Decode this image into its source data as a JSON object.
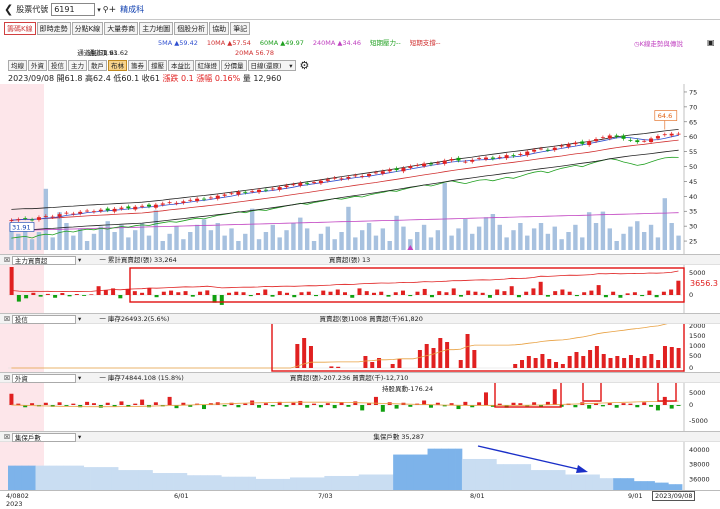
{
  "topbar": {
    "stock_code_label": "股票代號",
    "stock_code_value": "6191",
    "stock_name": "精成科"
  },
  "tabs": [
    "籌碼K線",
    "即時走勢",
    "分點K線",
    "大量券商",
    "主力地圖",
    "個股分析",
    "協助",
    "筆記"
  ],
  "legend": {
    "ma5": "5MA ▲59.42",
    "ma10": "10MA ▲57.54",
    "ma60": "60MA ▲49.97",
    "ma240": "240MA ▲34.46",
    "short_pressure": "短期壓力--",
    "short_support": "短期支撐--",
    "upper_band": "通道頂 61.62",
    "lower_band": "通道底 51.93",
    "ma20": "20MA 56.78",
    "kline_link": "K線走勢與傳說",
    "colors": {
      "ma5": "#3050d0",
      "ma10": "#d03030",
      "ma60": "#20a020",
      "ma240": "#c040c0",
      "short_pressure": "#20a020",
      "short_support": "#d03030",
      "upper_band": "#222222",
      "lower_band": "#222222",
      "ma20": "#d03030",
      "kline_link": "#c040c0"
    }
  },
  "toolbar": {
    "buttons": [
      "均線",
      "外資",
      "投信",
      "主力",
      "散戶",
      "布林",
      "籌券",
      "撐壓",
      "本益比",
      "紅綠燈",
      "分價量"
    ],
    "active": "布林",
    "period_select": "日線(還原)"
  },
  "quote": {
    "date": "2023/09/08",
    "open_label": "開",
    "open": "61.8",
    "high_label": "高",
    "high": "62.4",
    "low_label": "低",
    "low": "60.1",
    "close_label": "收",
    "close": "61",
    "change": "漲跌 0.1",
    "change_pct": "漲幅 0.16%",
    "volume": "量 12,960"
  },
  "price_panel": {
    "high_marker": "64.6",
    "low_marker": "31.91",
    "y_ticks": [
      "75",
      "70",
      "65",
      "60",
      "55",
      "50",
      "45",
      "40",
      "35",
      "30",
      "25"
    ]
  },
  "panels": {
    "main_force": {
      "select": "主力買賣超",
      "legend_cum": "一 累計買賣超(張) 33,264",
      "legend_bar": "買賣超(張) 13",
      "y_ticks": [
        "5000",
        "0"
      ],
      "value_label": "3656.3"
    },
    "trust": {
      "select": "投信",
      "legend_inv": "一 庫存26493.2(5.6%)",
      "legend_bar": "買賣超(張)1008 買賣超(千)61,820",
      "y_ticks": [
        "2000",
        "1500",
        "1000",
        "500",
        "0"
      ]
    },
    "foreign": {
      "select": "外資",
      "legend_inv": "一 庫存74844.108 (15.8%)",
      "legend_bar": "買賣超(張)-207.236 買賣超(千)-12,710",
      "legend_ratio": "持股異動-176.24",
      "y_ticks": [
        "5000",
        "0",
        "-5000"
      ]
    },
    "holders": {
      "select": "集保戶數",
      "legend": "集保戶數 35,287",
      "y_ticks": [
        "40000",
        "38000",
        "36000"
      ]
    }
  },
  "x_axis": {
    "labels": [
      "4/",
      "6/01",
      "7/03",
      "8/01",
      "9/01"
    ],
    "start_label": "4/0802",
    "year": "2023",
    "current_date": "2023/09/08"
  },
  "chart_data": [
    {
      "type": "candlestick",
      "title": "",
      "ylim": [
        22,
        77
      ],
      "close": [
        32,
        32.3,
        32.6,
        32.1,
        33,
        33.4,
        33.2,
        34,
        34.5,
        34.2,
        34.8,
        35.2,
        35,
        35.5,
        35.3,
        35.8,
        36.2,
        36,
        36.5,
        36.8,
        36.6,
        37.2,
        37.6,
        38,
        37.8,
        38.3,
        38.8,
        39.2,
        39,
        39.6,
        40.2,
        40.6,
        41,
        41.5,
        41.2,
        41.8,
        42.2,
        42,
        42.6,
        43.1,
        43.6,
        44,
        44.5,
        44.2,
        44.8,
        45.2,
        45.7,
        46.2,
        46,
        46.5,
        47,
        46.8,
        47.5,
        48,
        48.4,
        49,
        48.8,
        49.5,
        50.1,
        50.5,
        51,
        50.7,
        51.3,
        52,
        52.5,
        52,
        51.6,
        52.2,
        52.8,
        53,
        52.6,
        53.2,
        53.8,
        53.5,
        54.2,
        55,
        55.6,
        56,
        55.5,
        56.3,
        57,
        57.5,
        58,
        57.6,
        58.5,
        59.2,
        59.8,
        60.4,
        60,
        59.3,
        58.8,
        58.2,
        58.6,
        59.4,
        60.2,
        60.8,
        61,
        61
      ],
      "ma20_end": 56.78,
      "ma60_end": 49.97,
      "ma240_end": 34.46,
      "volume_scale_max": 6000
    },
    {
      "type": "bar",
      "title": "主力買賣超",
      "note": "daily net buy (lots), cumulative line",
      "values": [
        4200,
        -600,
        -300,
        200,
        -150,
        100,
        -250,
        180,
        -120,
        90,
        -80,
        60,
        800,
        450,
        600,
        -300,
        500,
        350,
        200,
        600,
        -200,
        300,
        400,
        250,
        350,
        -150,
        300,
        420,
        -700,
        -900,
        200,
        300,
        250,
        -100,
        180,
        500,
        -150,
        350,
        200,
        -200,
        250,
        300,
        -100,
        400,
        300,
        500,
        250,
        -250,
        600,
        350,
        200,
        300,
        -150,
        250,
        400,
        -100,
        300,
        550,
        -200,
        350,
        250,
        600,
        -150,
        400,
        300,
        200,
        -250,
        500,
        350,
        800,
        -200,
        300,
        600,
        1200,
        -150,
        350,
        500,
        300,
        -100,
        250,
        400,
        900,
        -200,
        300,
        -250,
        150,
        250,
        -100,
        400,
        -200,
        300,
        500,
        1300
      ],
      "cum_end": 33264
    },
    {
      "type": "bar",
      "title": "投信",
      "values": [
        0,
        0,
        0,
        0,
        0,
        0,
        0,
        0,
        0,
        0,
        0,
        0,
        0,
        0,
        0,
        0,
        0,
        0,
        0,
        0,
        0,
        0,
        0,
        0,
        0,
        0,
        0,
        0,
        0,
        0,
        0,
        0,
        0,
        0,
        0,
        0,
        0,
        0,
        0,
        0,
        0,
        0,
        1200,
        1500,
        1100,
        0,
        0,
        80,
        60,
        0,
        0,
        0,
        600,
        300,
        500,
        0,
        200,
        450,
        0,
        0,
        900,
        1200,
        1000,
        1500,
        1300,
        0,
        400,
        1700,
        900,
        0,
        0,
        0,
        0,
        0,
        200,
        400,
        600,
        500,
        700,
        450,
        300,
        200,
        600,
        800,
        600,
        900,
        1100,
        700,
        500,
        600,
        500,
        650,
        500,
        600,
        700,
        400,
        1100,
        1050,
        1000
      ],
      "inventory_end": 26493.2
    },
    {
      "type": "bar",
      "title": "外資",
      "values": [
        2500,
        300,
        -500,
        400,
        -300,
        500,
        -400,
        600,
        -200,
        300,
        -500,
        700,
        400,
        -600,
        500,
        -300,
        800,
        -400,
        300,
        1200,
        -500,
        600,
        -300,
        1800,
        -700,
        500,
        -400,
        300,
        -900,
        400,
        600,
        -300,
        500,
        -500,
        300,
        1000,
        -600,
        400,
        -300,
        700,
        -400,
        500,
        900,
        -600,
        300,
        -500,
        400,
        -700,
        600,
        -400,
        800,
        -1200,
        400,
        1800,
        -1500,
        600,
        -800,
        500,
        -400,
        300,
        1000,
        -600,
        500,
        -300,
        400,
        -900,
        700,
        -500,
        600,
        2800,
        -400,
        300,
        -600,
        500,
        400,
        -300,
        600,
        -500,
        700,
        3500,
        -400,
        300,
        -500,
        600,
        -800,
        400,
        -300,
        500,
        -600,
        400,
        300,
        -500,
        600,
        -400,
        -1200,
        1800,
        -800,
        -207
      ],
      "inventory_end": 74844.108
    },
    {
      "type": "area",
      "title": "集保戶數",
      "ylim": [
        34500,
        41000
      ],
      "values": [
        37800,
        37800,
        37800,
        37800,
        37800,
        37800,
        37800,
        37800,
        37800,
        37800,
        37800,
        37600,
        37600,
        37600,
        37600,
        37600,
        37200,
        37200,
        37200,
        37200,
        37200,
        36800,
        36800,
        36800,
        36800,
        36800,
        36500,
        36500,
        36500,
        36500,
        36500,
        36300,
        36300,
        36300,
        36300,
        36300,
        36000,
        36000,
        36000,
        36000,
        36000,
        36200,
        36200,
        36200,
        36200,
        36200,
        36400,
        36400,
        36400,
        36400,
        36400,
        36600,
        36600,
        36600,
        36600,
        36600,
        39300,
        39300,
        39300,
        39300,
        39300,
        40100,
        40100,
        40100,
        40100,
        40100,
        38700,
        38700,
        38700,
        38700,
        38700,
        38000,
        38000,
        38000,
        38000,
        38000,
        37200,
        37200,
        37200,
        37200,
        37200,
        36600,
        36600,
        36600,
        36600,
        36600,
        36100,
        36100,
        36100,
        36100,
        36100,
        35700,
        35700,
        35700,
        35500,
        35500,
        35287,
        35287
      ],
      "end_value": 35287
    }
  ]
}
